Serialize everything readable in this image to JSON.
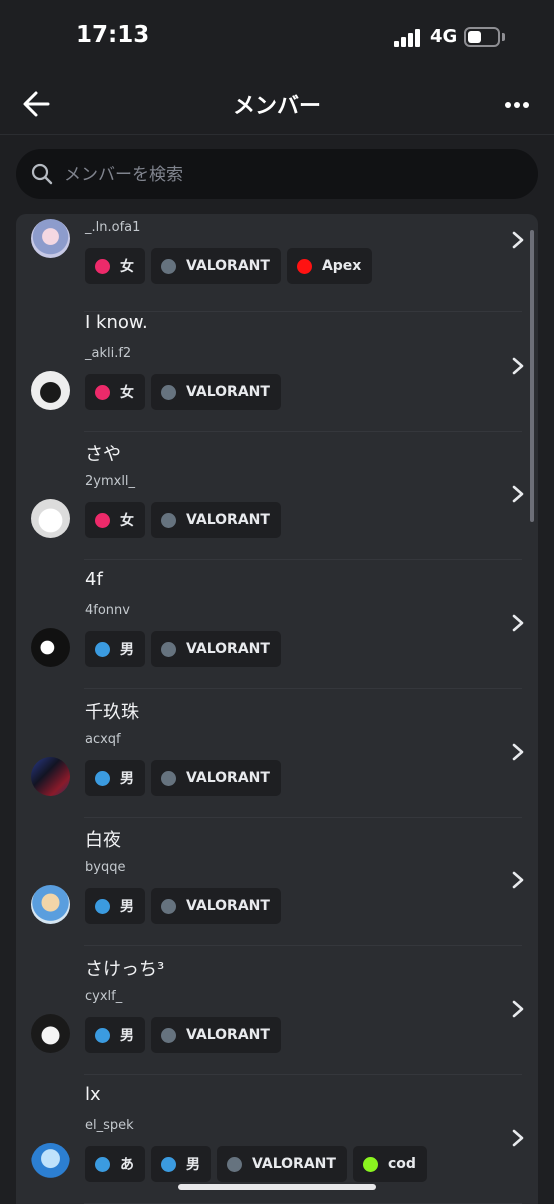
{
  "status_bar": {
    "time": "17:13",
    "network": "4G",
    "battery_level": 0.45
  },
  "header": {
    "title": "メンバー"
  },
  "search": {
    "placeholder": "メンバーを検索"
  },
  "colors": {
    "female": "#ed2a6a",
    "male": "#3b9be0",
    "gray": "#66737f",
    "apex": "#ff1212",
    "cod": "#8af51f"
  },
  "members": [
    {
      "name": "",
      "username": "_.ln.ofa1",
      "tags": [
        {
          "label": "女",
          "color": "#ed2a6a"
        },
        {
          "label": "VALORANT",
          "color": "#66737f"
        },
        {
          "label": "Apex",
          "color": "#ff1212"
        }
      ]
    },
    {
      "name": "I know.",
      "username": "_akli.f2",
      "tags": [
        {
          "label": "女",
          "color": "#ed2a6a"
        },
        {
          "label": "VALORANT",
          "color": "#66737f"
        }
      ]
    },
    {
      "name": "さや",
      "username": "2ymxll_",
      "tags": [
        {
          "label": "女",
          "color": "#ed2a6a"
        },
        {
          "label": "VALORANT",
          "color": "#66737f"
        }
      ]
    },
    {
      "name": "4f",
      "username": "4fonnv",
      "tags": [
        {
          "label": "男",
          "color": "#3b9be0"
        },
        {
          "label": "VALORANT",
          "color": "#66737f"
        }
      ]
    },
    {
      "name": "千玖珠",
      "username": "acxqf",
      "tags": [
        {
          "label": "男",
          "color": "#3b9be0"
        },
        {
          "label": "VALORANT",
          "color": "#66737f"
        }
      ]
    },
    {
      "name": "白夜",
      "username": "byqqe",
      "tags": [
        {
          "label": "男",
          "color": "#3b9be0"
        },
        {
          "label": "VALORANT",
          "color": "#66737f"
        }
      ]
    },
    {
      "name": "さけっち³",
      "username": "cyxlf_",
      "tags": [
        {
          "label": "男",
          "color": "#3b9be0"
        },
        {
          "label": "VALORANT",
          "color": "#66737f"
        }
      ]
    },
    {
      "name": "lx",
      "username": "el_spek",
      "tags": [
        {
          "label": "あ",
          "color": "#3b9be0"
        },
        {
          "label": "男",
          "color": "#3b9be0"
        },
        {
          "label": "VALORANT",
          "color": "#66737f"
        },
        {
          "label": "cod",
          "color": "#8af51f"
        }
      ]
    }
  ]
}
